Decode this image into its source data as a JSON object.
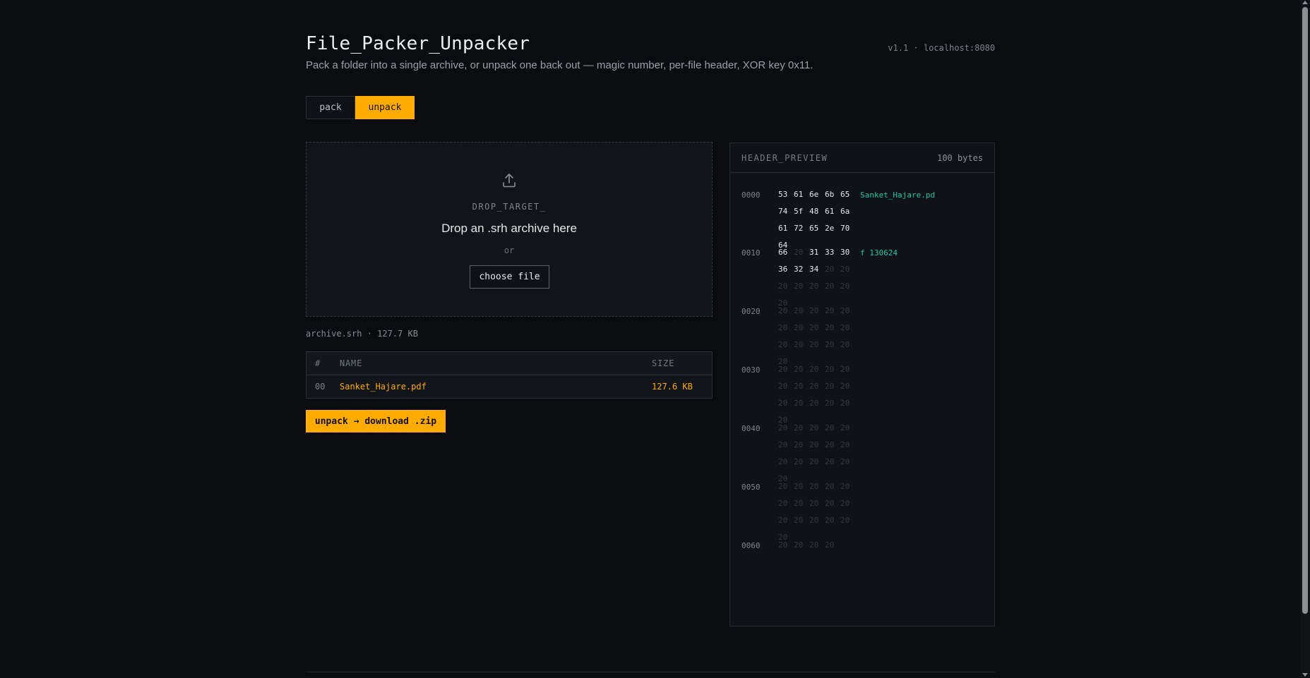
{
  "header": {
    "title": "File_Packer_Unpacker",
    "subtitle": "Pack a folder into a single archive, or unpack one back out — magic number, per-file header, XOR key 0x11.",
    "version": "v1.1 · localhost:8080"
  },
  "tabs": [
    {
      "label": "pack",
      "active": false
    },
    {
      "label": "unpack",
      "active": true
    }
  ],
  "dropzone": {
    "icon": "upload-icon",
    "label": "DROP_TARGET_",
    "text": "Drop an .srh archive here",
    "or": "or",
    "button": "choose file"
  },
  "archive_info": "archive.srh · 127.7 KB",
  "table": {
    "columns": [
      "#",
      "NAME",
      "SIZE"
    ],
    "rows": [
      {
        "num": "00",
        "name": "Sanket_Hajare.pdf",
        "size": "127.6 KB"
      }
    ]
  },
  "unpack_button": "unpack → download .zip",
  "hex": {
    "title": "HEADER_PREVIEW",
    "count": "100 bytes",
    "rows": [
      {
        "offset": "0000",
        "bytes": [
          "53",
          "61",
          "6e",
          "6b",
          "65",
          "74",
          "5f",
          "48",
          "61",
          "6a",
          "61",
          "72",
          "65",
          "2e",
          "70",
          "64"
        ],
        "active": 16,
        "ascii": "Sanket_Hajare.pd"
      },
      {
        "offset": "0010",
        "bytes": [
          "66",
          "20",
          "31",
          "33",
          "30",
          "36",
          "32",
          "34",
          "20",
          "20",
          "20",
          "20",
          "20",
          "20",
          "20",
          "20"
        ],
        "active": 8,
        "space_at": 1,
        "ascii": "f 130624"
      },
      {
        "offset": "0020",
        "bytes": [
          "20",
          "20",
          "20",
          "20",
          "20",
          "20",
          "20",
          "20",
          "20",
          "20",
          "20",
          "20",
          "20",
          "20",
          "20",
          "20"
        ],
        "active": 0,
        "ascii": ""
      },
      {
        "offset": "0030",
        "bytes": [
          "20",
          "20",
          "20",
          "20",
          "20",
          "20",
          "20",
          "20",
          "20",
          "20",
          "20",
          "20",
          "20",
          "20",
          "20",
          "20"
        ],
        "active": 0,
        "ascii": ""
      },
      {
        "offset": "0040",
        "bytes": [
          "20",
          "20",
          "20",
          "20",
          "20",
          "20",
          "20",
          "20",
          "20",
          "20",
          "20",
          "20",
          "20",
          "20",
          "20",
          "20"
        ],
        "active": 0,
        "ascii": ""
      },
      {
        "offset": "0050",
        "bytes": [
          "20",
          "20",
          "20",
          "20",
          "20",
          "20",
          "20",
          "20",
          "20",
          "20",
          "20",
          "20",
          "20",
          "20",
          "20",
          "20"
        ],
        "active": 0,
        "ascii": ""
      },
      {
        "offset": "0060",
        "bytes": [
          "20",
          "20",
          "20",
          "20"
        ],
        "active": 0,
        "ascii": ""
      }
    ]
  },
  "colors": {
    "accent": "#ffab00",
    "ascii": "#21c1a8",
    "background": "#0a0c0f"
  }
}
